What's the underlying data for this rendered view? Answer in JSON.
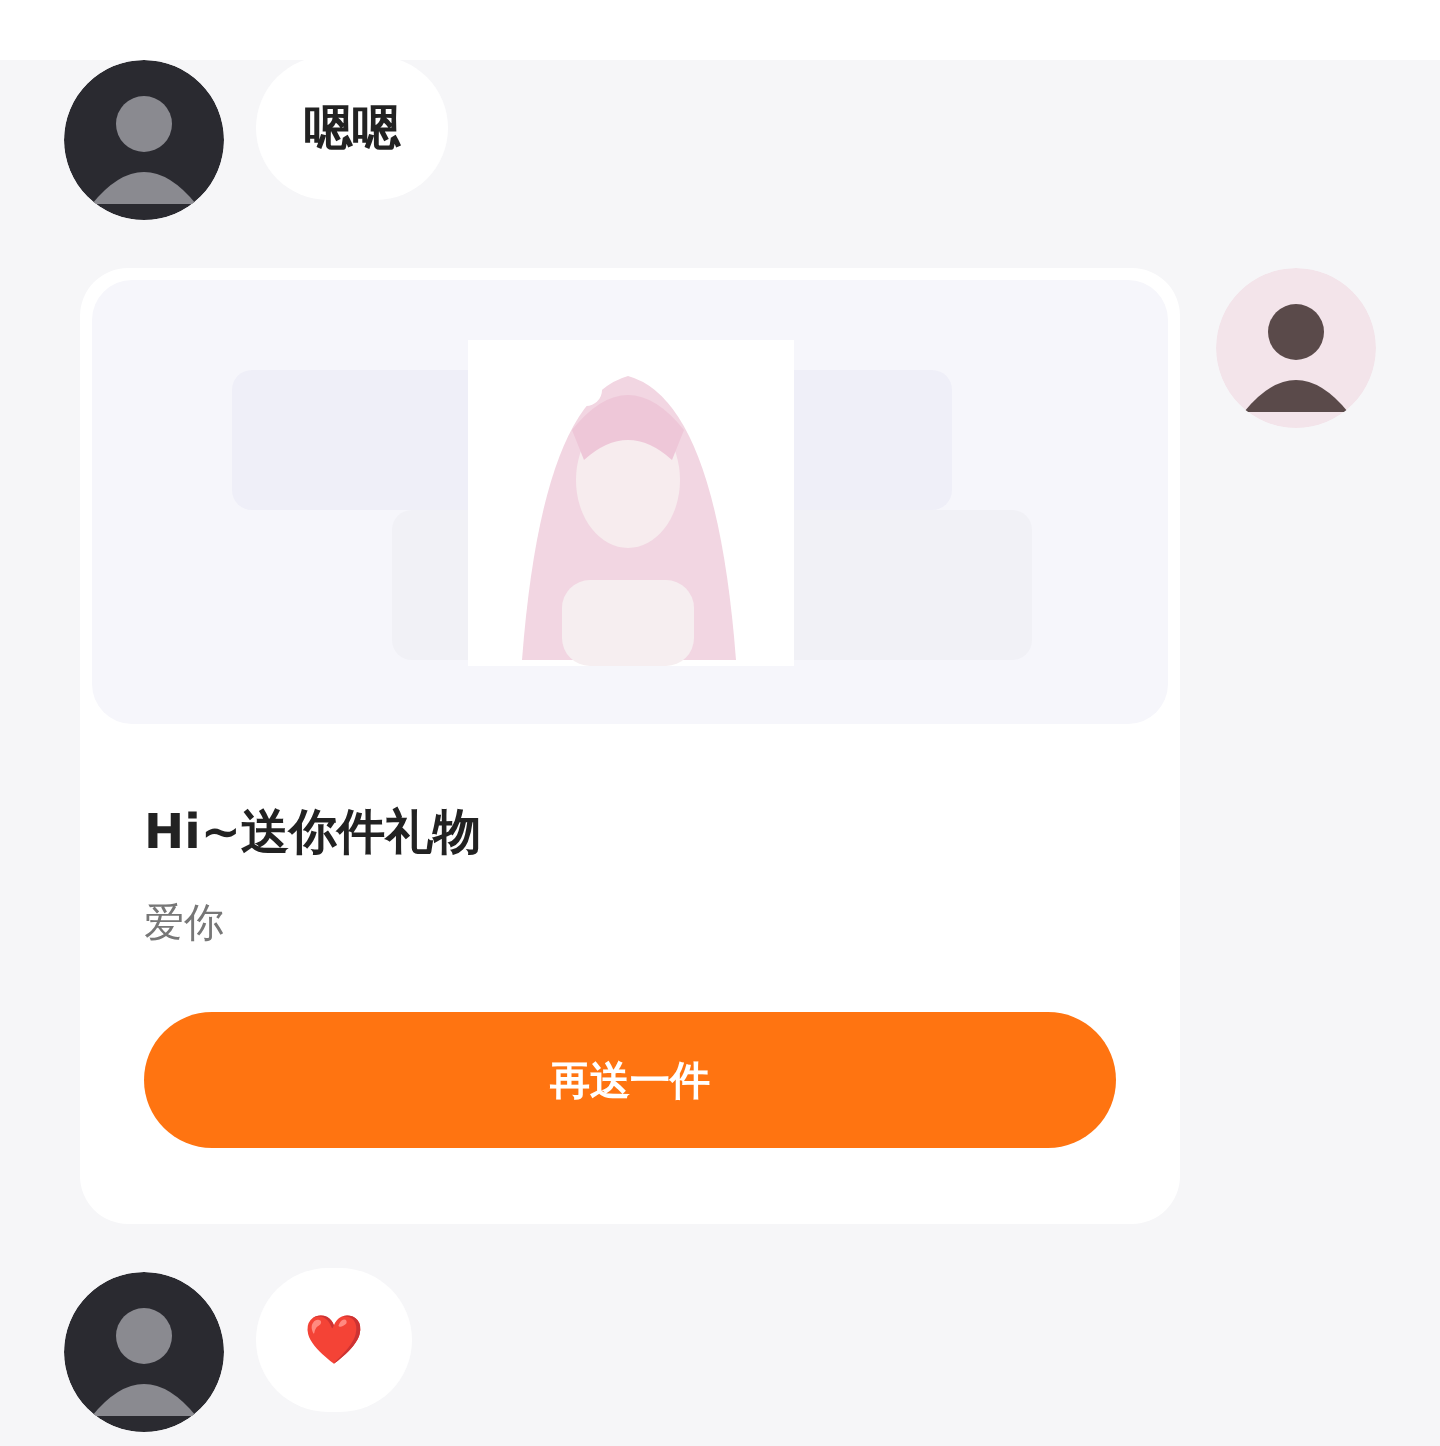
{
  "messages": [
    {
      "kind": "text",
      "outgoing": false,
      "text": "嗯嗯"
    },
    {
      "kind": "gift",
      "outgoing": true,
      "title": "Hi~送你件礼物",
      "subtitle": "爱你",
      "button": "再送一件"
    },
    {
      "kind": "text",
      "outgoing": false,
      "text": "❤️"
    }
  ]
}
